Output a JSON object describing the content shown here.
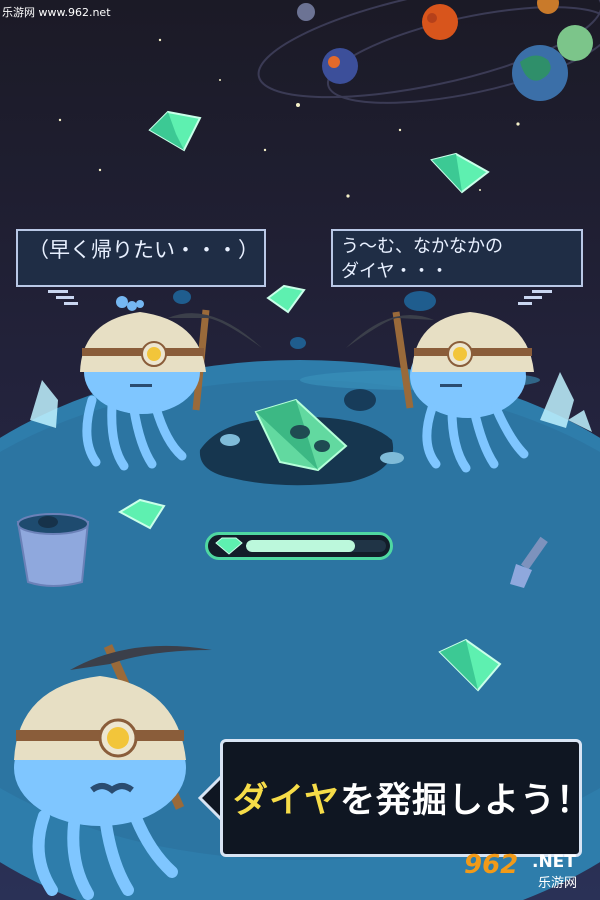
{
  "watermark_top": "乐游网 www.962.net",
  "speech_left": "（早く帰りたい・・・）",
  "speech_right_line1": "う〜む、なかなかの",
  "speech_right_line2": "ダイヤ・・・",
  "caption_highlight": "ダイヤ",
  "caption_rest": "を発掘しよう！",
  "progress_value": 0.78,
  "watermark_logo": {
    "number": "962",
    "domain": ".NET",
    "name": "乐游网"
  },
  "colors": {
    "sky": "#1c1b2e",
    "planet": "#2e7dab",
    "gem": "#5ef0b0",
    "caption_highlight": "#f6dc48"
  }
}
